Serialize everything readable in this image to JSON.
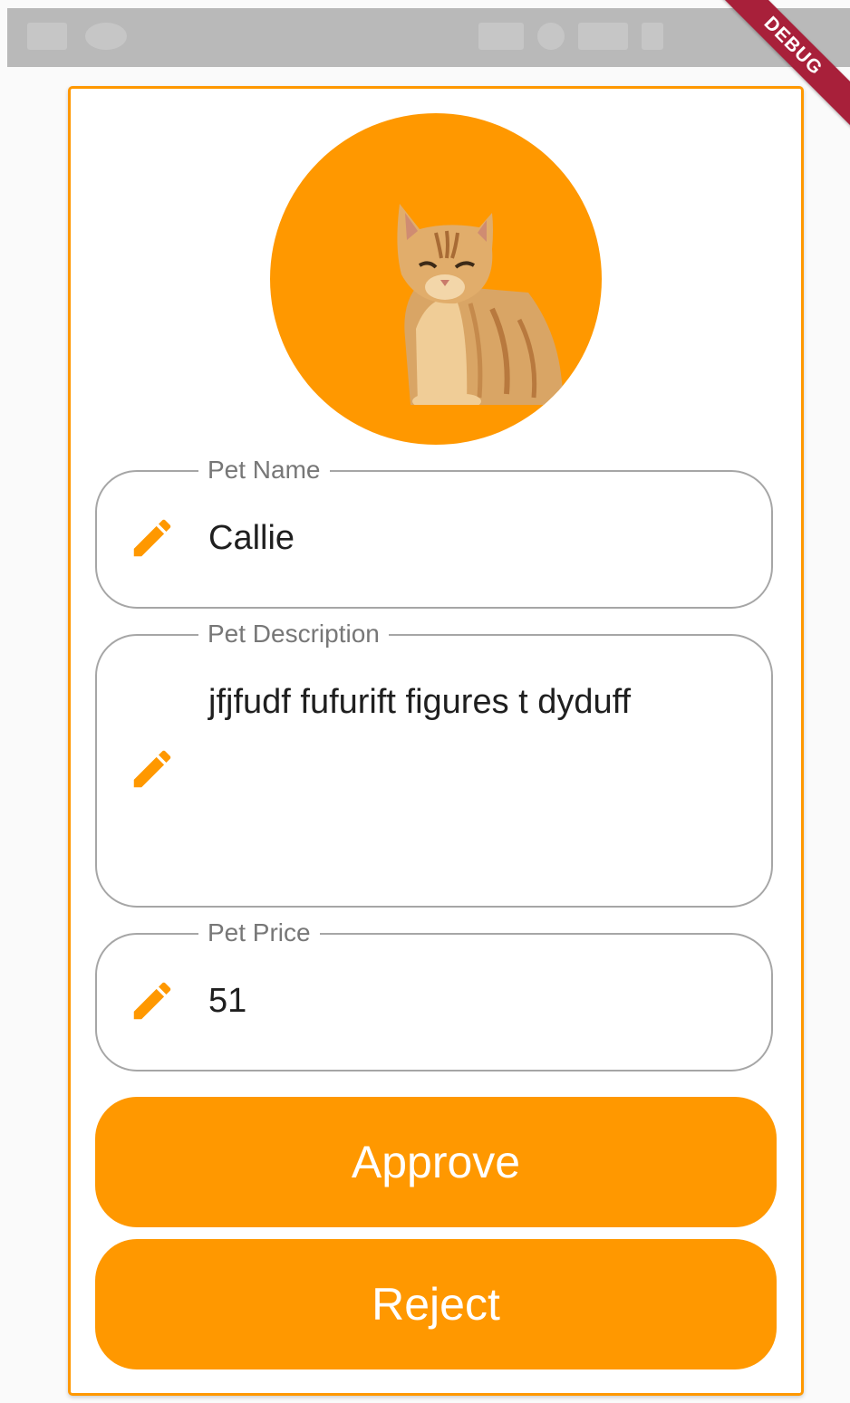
{
  "debug_banner": "DEBUG",
  "form": {
    "pet_name": {
      "label": "Pet Name",
      "value": "Callie",
      "icon": "pencil-icon"
    },
    "pet_description": {
      "label": "Pet Description",
      "value": "jfjfudf fufurift figures t dyduff",
      "icon": "pencil-icon"
    },
    "pet_price": {
      "label": "Pet Price",
      "value": "51",
      "icon": "pencil-icon"
    }
  },
  "buttons": {
    "approve": "Approve",
    "reject": "Reject"
  },
  "colors": {
    "accent": "#ff9800",
    "field_border": "#a6a6a6",
    "label_text": "#777777",
    "value_text": "#1f1f1f",
    "debug_ribbon": "#a8203a"
  }
}
